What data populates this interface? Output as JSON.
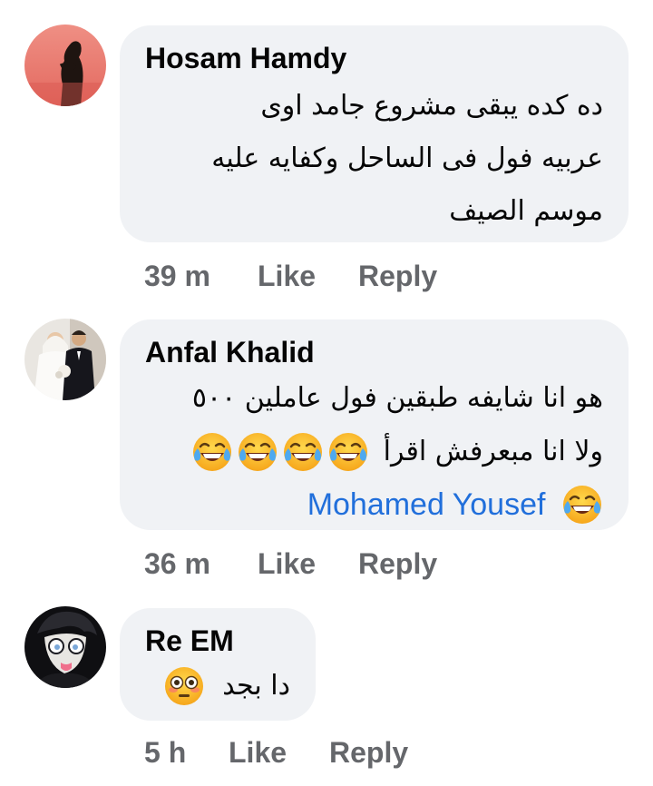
{
  "comments": [
    {
      "author": "Hosam Hamdy",
      "lines": [
        "ده كده يبقى مشروع جامد اوى",
        "عربيه فول فى الساحل وكفايه عليه",
        "موسم الصيف"
      ],
      "time": "39 m",
      "like": "Like",
      "reply": "Reply"
    },
    {
      "author": "Anfal Khalid",
      "lines": [
        "هو انا شايفه طبقين فول عاملين ٥٠٠",
        "ولا انا مبعرفش اقرأ"
      ],
      "mention": "Mohamed Yousef",
      "time": "36 m",
      "like": "Like",
      "reply": "Reply"
    },
    {
      "author": "Re EM",
      "lines": [
        "دا بجد"
      ],
      "time": "5 h",
      "like": "Like",
      "reply": "Reply"
    }
  ],
  "icons": {
    "laugh_emoji": "face-with-tears-of-joy-icon",
    "flushed_emoji": "flushed-face-icon"
  },
  "colors": {
    "bubble": "#f0f2f5",
    "mention": "#216fdb",
    "meta": "#65676b"
  }
}
